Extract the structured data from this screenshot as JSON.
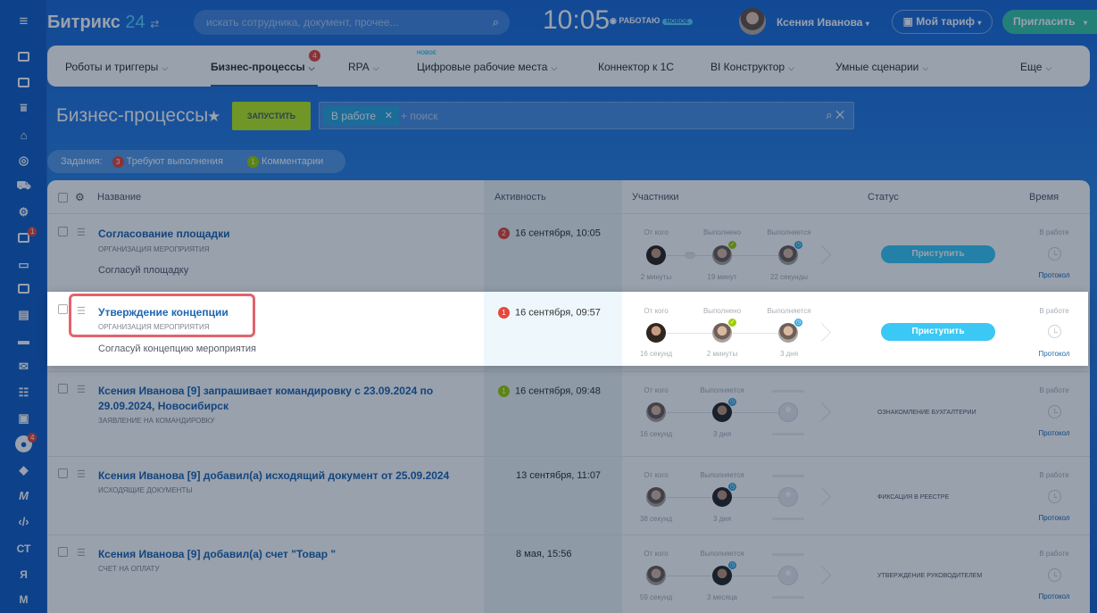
{
  "topbar": {
    "logo_name": "Битрикс",
    "logo_num": "24",
    "search_placeholder": "искать сотрудника, документ, прочее...",
    "time": "10:05",
    "work_status": "РАБОТАЮ",
    "work_new": "НОВОЕ",
    "user_name": "Ксения Иванова",
    "tariff_label": "Мой тариф",
    "invite_label": "Пригласить"
  },
  "leftbar": {
    "badges": [
      "1",
      "4"
    ],
    "letters": [
      "СТ",
      "Я",
      "М"
    ]
  },
  "menu": {
    "items": [
      "Роботы и триггеры",
      "Бизнес-процессы",
      "RPA",
      "Цифровые рабочие места",
      "Коннектор к 1С",
      "BI Конструктор",
      "Умные сценарии",
      "Еще"
    ],
    "badge": "4",
    "new_label": "НОВОЕ"
  },
  "page": {
    "title": "Бизнес-процессы",
    "start_button": "ЗАПУСТИТЬ",
    "filter_chip": "В работе",
    "filter_placeholder": "+ поиск"
  },
  "tasks_bar": {
    "label": "Задания:",
    "required_count": "3",
    "required_label": "Требуют выполнения",
    "comments_count": "1",
    "comments_label": "Комментарии"
  },
  "columns": {
    "name": "Название",
    "activity": "Активность",
    "participants": "Участники",
    "status": "Статус",
    "time": "Время"
  },
  "participant_labels": {
    "from": "От кого",
    "done": "Выполнено",
    "running": "Выполняется"
  },
  "rows": [
    {
      "title": "Согласование площадки",
      "subtitle": "ОРГАНИЗАЦИЯ МЕРОПРИЯТИЯ",
      "description": "Согласуй площадку",
      "activity_count": "2",
      "activity_date": "16 сентября, 10:05",
      "times": [
        "2 минуты",
        "19 минут",
        "22 секунды"
      ],
      "status_button": "Приступить",
      "time_label": "В работе",
      "protocol": "Протокол"
    },
    {
      "title": "Утверждение концепции",
      "subtitle": "ОРГАНИЗАЦИЯ МЕРОПРИЯТИЯ",
      "description": "Согласуй концепцию мероприятия",
      "activity_count": "1",
      "activity_date": "16 сентября, 09:57",
      "times": [
        "16 секунд",
        "2 минуты",
        "3 дня"
      ],
      "status_button": "Приступить",
      "time_label": "В работе",
      "protocol": "Протокол"
    },
    {
      "title_line1": "Ксения Иванова [9] запрашивает командировку с 23.09.2024 по",
      "title_line2": "29.09.2024, Новосибирск",
      "subtitle": "ЗАЯВЛЕНИЕ НА КОМАНДИРОВКУ",
      "activity_count": "1",
      "activity_date": "16 сентября, 09:48",
      "times": [
        "16 секунд",
        "3 дня"
      ],
      "status_text": "ОЗНАКОМЛЕНИЕ БУХГАЛТЕРИИ",
      "time_label": "В работе",
      "protocol": "Протокол"
    },
    {
      "title": "Ксения Иванова [9] добавил(а) исходящий документ от 25.09.2024",
      "subtitle": "ИСХОДЯЩИЕ ДОКУМЕНТЫ",
      "activity_date": "13 сентября, 11:07",
      "times": [
        "38 секунд",
        "3 дня"
      ],
      "status_text": "ФИКСАЦИЯ В РЕЕСТРЕ",
      "time_label": "В работе",
      "protocol": "Протокол"
    },
    {
      "title": "Ксения Иванова [9] добавил(а) счет \"Товар \"",
      "subtitle": "СЧЕТ НА ОПЛАТУ",
      "activity_date": "8 мая, 15:56",
      "times": [
        "59 секунд",
        "3 месяца"
      ],
      "status_text": "УТВЕРЖДЕНИЕ РУКОВОДИТЕЛЕМ",
      "time_label": "В работе",
      "protocol": "Протокол"
    }
  ],
  "colors": {
    "accent": "#2067b0",
    "start_button": "#bbed21",
    "action_button": "#3bc8f5",
    "badge_red": "#e8483b",
    "badge_green": "#9dcf00",
    "highlight_frame": "#e2636c"
  }
}
